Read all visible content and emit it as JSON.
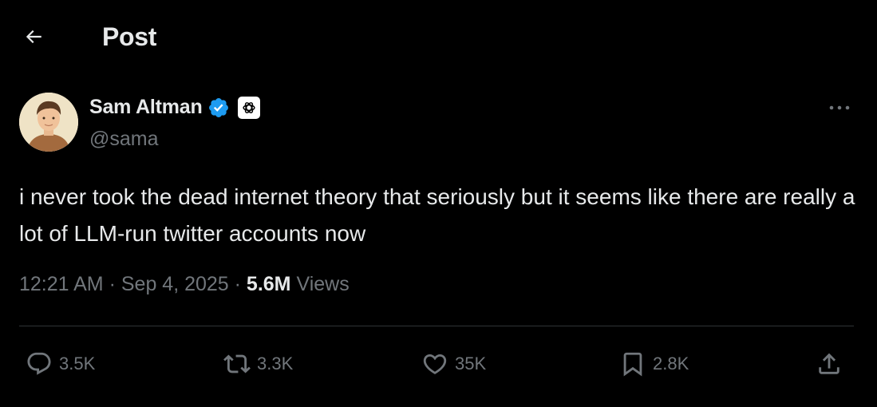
{
  "header": {
    "title": "Post"
  },
  "author": {
    "name": "Sam Altman",
    "handle": "@sama"
  },
  "tweet": {
    "text": "i never took the dead internet theory that seriously but it seems like there are really a lot of LLM-run twitter accounts now"
  },
  "meta": {
    "time": "12:21 AM",
    "separator": " · ",
    "date": "Sep 4, 2025",
    "views_count": "5.6M",
    "views_label": "Views"
  },
  "actions": {
    "replies": "3.5K",
    "reposts": "3.3K",
    "likes": "35K",
    "bookmarks": "2.8K"
  },
  "colors": {
    "background": "#000000",
    "text_primary": "#e7e9ea",
    "text_secondary": "#71767b",
    "verified": "#1d9bf0",
    "divider": "#2f3336"
  }
}
